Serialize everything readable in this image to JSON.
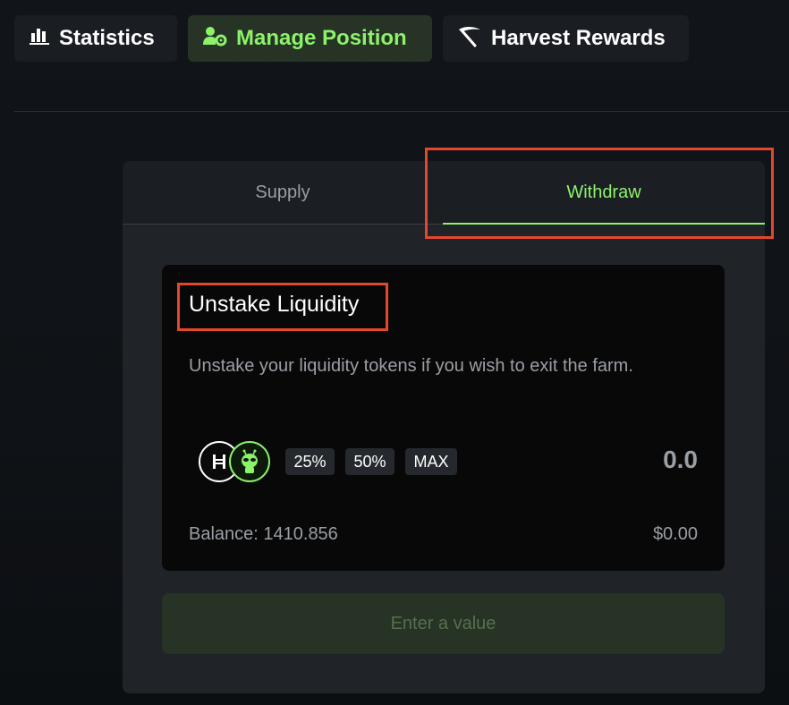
{
  "nav": {
    "tabs": [
      {
        "label": "Statistics",
        "icon": "bar-chart-icon",
        "active": false
      },
      {
        "label": "Manage Position",
        "icon": "users-gear-icon",
        "active": true
      },
      {
        "label": "Harvest Rewards",
        "icon": "scythe-icon",
        "active": false
      }
    ]
  },
  "panel": {
    "tabs": {
      "supply": "Supply",
      "withdraw": "Withdraw"
    },
    "active_tab": "Withdraw"
  },
  "card": {
    "title": "Unstake Liquidity",
    "description": "Unstake your liquidity tokens if you wish to exit the farm.",
    "percent_buttons": [
      "25%",
      "50%",
      "MAX"
    ],
    "amount": "0.0",
    "balance": "Balance: 1410.856",
    "usd_value": "$0.00",
    "token_icons": [
      "hbar-token-icon",
      "alien-token-icon"
    ]
  },
  "submit_button": "Enter a value",
  "colors": {
    "accent": "#8cf26a",
    "highlight": "#e4472d",
    "background": "#111519",
    "panel": "#1b1f23",
    "card": "#080808"
  }
}
